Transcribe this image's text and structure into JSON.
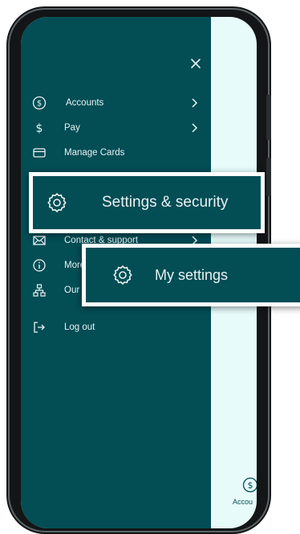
{
  "menu": {
    "close_icon": "close-icon",
    "items": [
      {
        "label": "Accounts",
        "icon": "dollar-circle-icon",
        "has_chevron": true
      },
      {
        "label": "Pay",
        "icon": "dollar-sign-icon",
        "has_chevron": true
      },
      {
        "label": "Manage Cards",
        "icon": "card-icon",
        "has_chevron": false
      },
      {
        "label": "Contact & support",
        "icon": "mail-icon",
        "has_chevron": true
      },
      {
        "label": "More",
        "icon": "info-icon",
        "has_chevron": false
      },
      {
        "label": "Our p",
        "icon": "network-icon",
        "has_chevron": false
      },
      {
        "label": "Log out",
        "icon": "logout-icon",
        "has_chevron": false
      }
    ]
  },
  "callouts": {
    "settings_security": {
      "label": "Settings & security",
      "icon": "gear-icon"
    },
    "my_settings": {
      "label": "My settings",
      "icon": "gear-icon"
    }
  },
  "bottom_nav": {
    "label": "Accou",
    "icon": "dollar-circle-icon"
  },
  "colors": {
    "drawer_bg": "#034d55",
    "menu_text": "#e6f3f3",
    "screen_bg": "#e7fbfb",
    "phone_frame": "#131516"
  }
}
